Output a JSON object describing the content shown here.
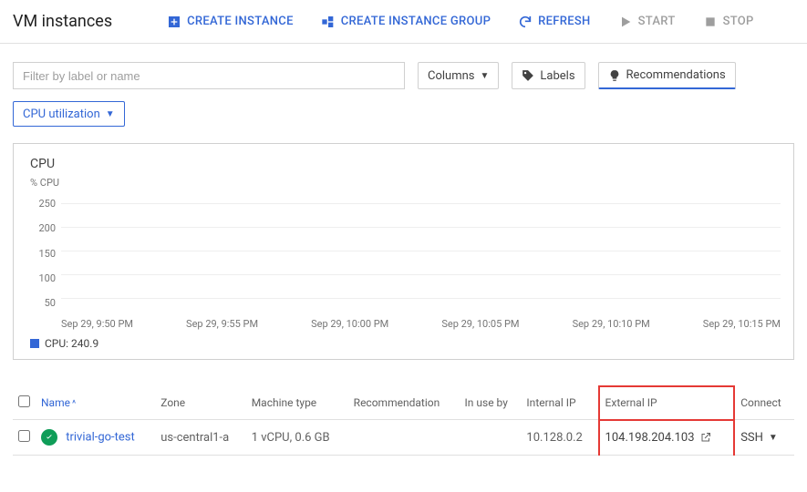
{
  "header": {
    "title": "VM instances",
    "create_instance": "CREATE INSTANCE",
    "create_group": "CREATE INSTANCE GROUP",
    "refresh": "REFRESH",
    "start": "START",
    "stop": "STOP"
  },
  "toolbar": {
    "filter_placeholder": "Filter by label or name",
    "columns": "Columns",
    "labels": "Labels",
    "recommendations": "Recommendations"
  },
  "cpu_dropdown": "CPU utilization",
  "chart_data": {
    "type": "line",
    "title": "CPU",
    "ylabel": "% CPU",
    "ylim": [
      0,
      250
    ],
    "y_ticks": [
      250,
      200,
      150,
      100,
      50
    ],
    "x_ticks": [
      "Sep 29, 9:50 PM",
      "Sep 29, 9:55 PM",
      "Sep 29, 10:00 PM",
      "Sep 29, 10:05 PM",
      "Sep 29, 10:10 PM",
      "Sep 29, 10:15 PM"
    ],
    "series": [
      {
        "name": "CPU",
        "value_label": "240.9",
        "values": []
      }
    ],
    "legend_text": "CPU: 240.9"
  },
  "table": {
    "headers": {
      "name": "Name",
      "zone": "Zone",
      "machine_type": "Machine type",
      "recommendation": "Recommendation",
      "in_use_by": "In use by",
      "internal_ip": "Internal IP",
      "external_ip": "External IP",
      "connect": "Connect"
    },
    "rows": [
      {
        "name": "trivial-go-test",
        "zone": "us-central1-a",
        "machine_type": "1 vCPU, 0.6 GB",
        "recommendation": "",
        "in_use_by": "",
        "internal_ip": "10.128.0.2",
        "external_ip": "104.198.204.103",
        "connect": "SSH"
      }
    ]
  }
}
